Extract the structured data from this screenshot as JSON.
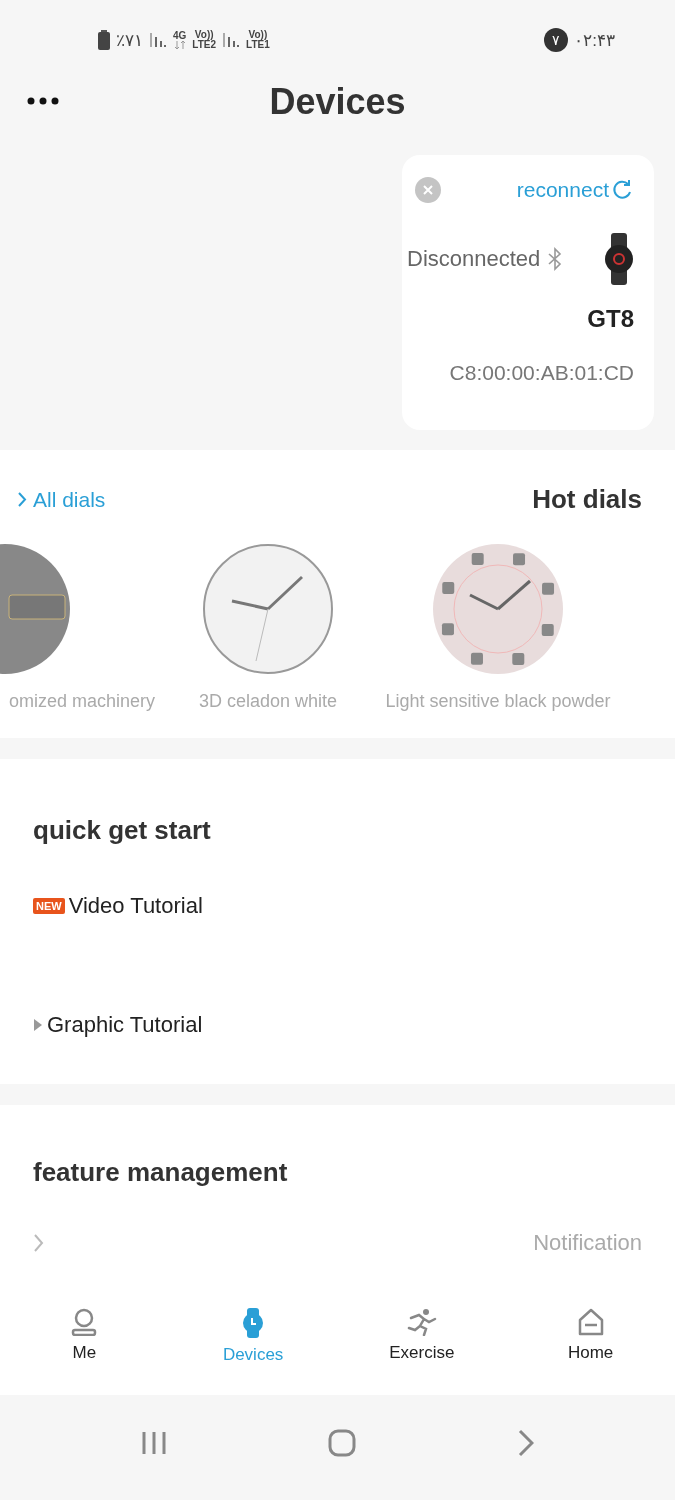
{
  "status_bar": {
    "battery": "٪۷۱",
    "network_1": "4G",
    "volte_1": "Vo))",
    "lte_1": "LTE2",
    "volte_2": "Vo))",
    "lte_2": "LTE1",
    "badge": "۷",
    "time": "۰۲:۴۳"
  },
  "header": {
    "title": "Devices"
  },
  "device_card": {
    "reconnect": "reconnect",
    "status": "Disconnected",
    "connected": false,
    "name": "GT8",
    "address": "C8:00:00:AB:01:CD"
  },
  "dials": {
    "title": "Hot dials",
    "link": "All dials",
    "items": [
      {
        "name": "omized machinery",
        "kind": "digital"
      },
      {
        "name": "3D celadon white",
        "kind": "analog"
      },
      {
        "name": "Light sensitive black powder",
        "kind": "pink"
      }
    ]
  },
  "quick_start": {
    "title": "quick get start",
    "items": [
      {
        "label": "Video Tutorial",
        "badge": "NEW"
      },
      {
        "label": "Graphic Tutorial"
      }
    ]
  },
  "features": {
    "title": "feature management",
    "items": [
      {
        "label": "Notification"
      }
    ]
  },
  "tabs": [
    {
      "label": "Me",
      "kind": "me",
      "selected": false
    },
    {
      "label": "Devices",
      "kind": "watch",
      "selected": true
    },
    {
      "label": "Exercise",
      "kind": "run",
      "selected": false
    },
    {
      "label": "Home",
      "kind": "home",
      "selected": false
    }
  ]
}
